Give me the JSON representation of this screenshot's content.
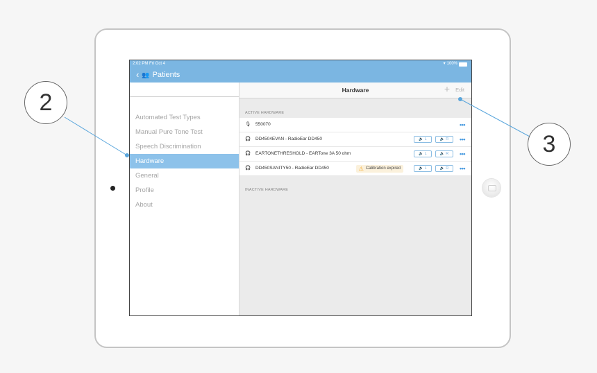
{
  "status_bar": {
    "time": "2:02 PM  Fri Oct 4",
    "battery": "100%"
  },
  "nav": {
    "back_label": "Patients"
  },
  "sidebar": {
    "items": [
      {
        "label": "Automated Test Types"
      },
      {
        "label": "Manual Pure Tone Test"
      },
      {
        "label": "Speech Discrimination"
      },
      {
        "label": "Hardware"
      },
      {
        "label": "General"
      },
      {
        "label": "Profile"
      },
      {
        "label": "About"
      }
    ],
    "selected": "Hardware"
  },
  "detail": {
    "title": "Hardware",
    "add_label": "+",
    "edit_label": "Edit",
    "active_section": "ACTIVE HARDWARE",
    "inactive_section": "INACTIVE HARDWARE",
    "more_label": "•••",
    "speaker_left": "L",
    "speaker_right": "R",
    "rows": [
      {
        "label": "550070",
        "icon": "microphone-icon"
      },
      {
        "label": "DD4504EVAN - RadioEar DD450",
        "icon": "headphones-icon"
      },
      {
        "label": "EARTONETHRESHOLD - EARTone 3A 50 ohm",
        "icon": "headphones-icon"
      },
      {
        "label": "DD450SANITY50 - RadioEar DD450",
        "icon": "headphones-icon",
        "warning": "Calibration expired"
      }
    ]
  },
  "callouts": {
    "left": "2",
    "right": "3"
  },
  "colors": {
    "accent": "#7bb6e2",
    "selection": "#8dc2ea",
    "link": "#4a9be0",
    "warning": "#f5a623"
  }
}
